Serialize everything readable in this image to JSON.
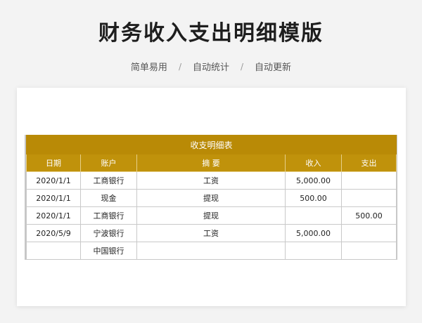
{
  "page": {
    "title": "财务收入支出明细模版",
    "tags": [
      "简单易用",
      "自动统计",
      "自动更新"
    ],
    "separator": "/"
  },
  "sheet": {
    "banner": "收支明细表",
    "columns": [
      "日期",
      "账户",
      "摘 要",
      "收入",
      "支出"
    ],
    "rows": [
      [
        "2020/1/1",
        "工商银行",
        "工资",
        "5,000.00",
        ""
      ],
      [
        "2020/1/1",
        "现金",
        "提现",
        "500.00",
        ""
      ],
      [
        "2020/1/1",
        "工商银行",
        "提现",
        "",
        "500.00"
      ],
      [
        "2020/5/9",
        "宁波银行",
        "工资",
        "5,000.00",
        ""
      ],
      [
        "",
        "中国银行",
        "",
        "",
        ""
      ]
    ]
  },
  "colors": {
    "header_gold": "#c0920b",
    "banner_gold": "#b98a06"
  }
}
